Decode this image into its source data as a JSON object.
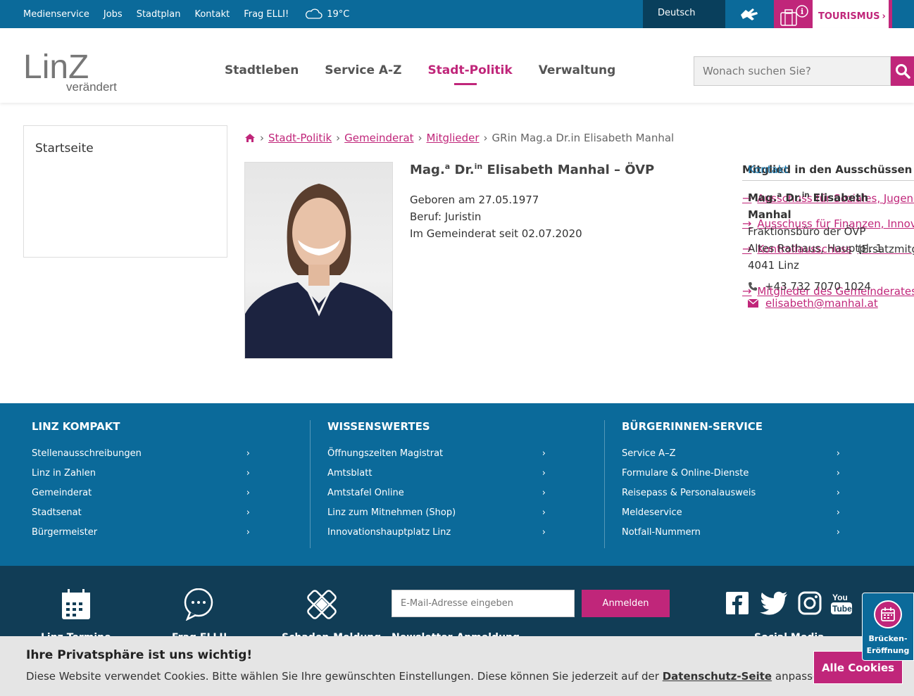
{
  "topbar": {
    "links": [
      "Medienservice",
      "Jobs",
      "Stadtplan",
      "Kontakt",
      "Frag ELLI!"
    ],
    "weather_temp": "19°C",
    "language": "Deutsch",
    "tourism_label": "TOURISMUS"
  },
  "header": {
    "logo_brand": "LinZ",
    "logo_tagline": "verändert",
    "nav": [
      "Stadtleben",
      "Service A-Z",
      "Stadt-Politik",
      "Verwaltung"
    ],
    "active_nav": "Stadt-Politik",
    "search_placeholder": "Wonach suchen Sie?"
  },
  "sidebar": {
    "item": "Startseite"
  },
  "breadcrumb": {
    "items": [
      "Stadt-Politik",
      "Gemeinderat",
      "Mitglieder"
    ],
    "current": "GRin Mag.a Dr.in Elisabeth Manhal"
  },
  "person": {
    "title_prefix1": "Mag.",
    "title_sup1": "a",
    "title_prefix2": "Dr.",
    "title_sup2": "in",
    "title_rest": "Elisabeth Manhal – ÖVP",
    "born": "Geboren am 27.05.1977",
    "job": "Beruf: Juristin",
    "since": "Im Gemeinderat seit 02.07.2020"
  },
  "right": {
    "committees_heading": "Mitglied in den Ausschüssen",
    "kontakt_heading": "Kontakt",
    "committees": [
      "Ausschuss für Soziales, Jugend",
      "Ausschuss für Finanzen, Innova",
      "Kontrollausschuss",
      "Mitglieder des Gemeinderates"
    ],
    "committee_note": "(Ersatzmitg",
    "contact_name_a": "Mag.",
    "contact_sup_a": "a",
    "contact_name_b": "Dr.",
    "contact_sup_b": "in",
    "contact_name_c": "Elisabeth",
    "contact_name_d": "Manhal",
    "office": "Fraktionsbüro der ÖVP",
    "address1": "Altes Rathaus, Hauptpl. 1",
    "address2": "4041 Linz",
    "phone": "+43 732 7070 1024",
    "email": "elisabeth@manhal.at"
  },
  "footer": {
    "columns": [
      {
        "title": "LINZ KOMPAKT",
        "links": [
          "Stellenausschreibungen",
          "Linz in Zahlen",
          "Gemeinderat",
          "Stadtsenat",
          "Bürgermeister"
        ]
      },
      {
        "title": "WISSENSWERTES",
        "links": [
          "Öffnungszeiten Magistrat",
          "Amtsblatt",
          "Amtstafel Online",
          "Linz zum Mitnehmen (Shop)",
          "Innovationshauptplatz Linz"
        ]
      },
      {
        "title": "BÜRGERINNEN-SERVICE",
        "links": [
          "Service A–Z",
          "Formulare & Online-Dienste",
          "Reisepass & Personalausweis",
          "Meldeservice",
          "Notfall-Nummern"
        ]
      }
    ],
    "newsletter_placeholder": "E-Mail-Adresse eingeben",
    "newsletter_button": "Anmelden",
    "bottom_labels": [
      "Linz Termine",
      "Frag ELLI!",
      "Schaden-Meldung",
      "Newsletter-Anmeldung",
      "Social Media"
    ],
    "bridge_label_1": "Brücken-",
    "bridge_label_2": "Eröffnung"
  },
  "cookie": {
    "title": "Ihre Privatsphäre ist uns wichtig!",
    "text_before": "Diese Website verwendet Cookies. Bitte wählen Sie Ihre gewünschten Einstellungen. Diese können Sie jederzeit auf der",
    "link": "Datenschutz-Seite",
    "text_after": "anpassen.",
    "button": "Alle Cookies"
  },
  "colors": {
    "brand_blue": "#0b6a9a",
    "brand_magenta": "#c0267a",
    "dark_footer": "#113d56"
  }
}
